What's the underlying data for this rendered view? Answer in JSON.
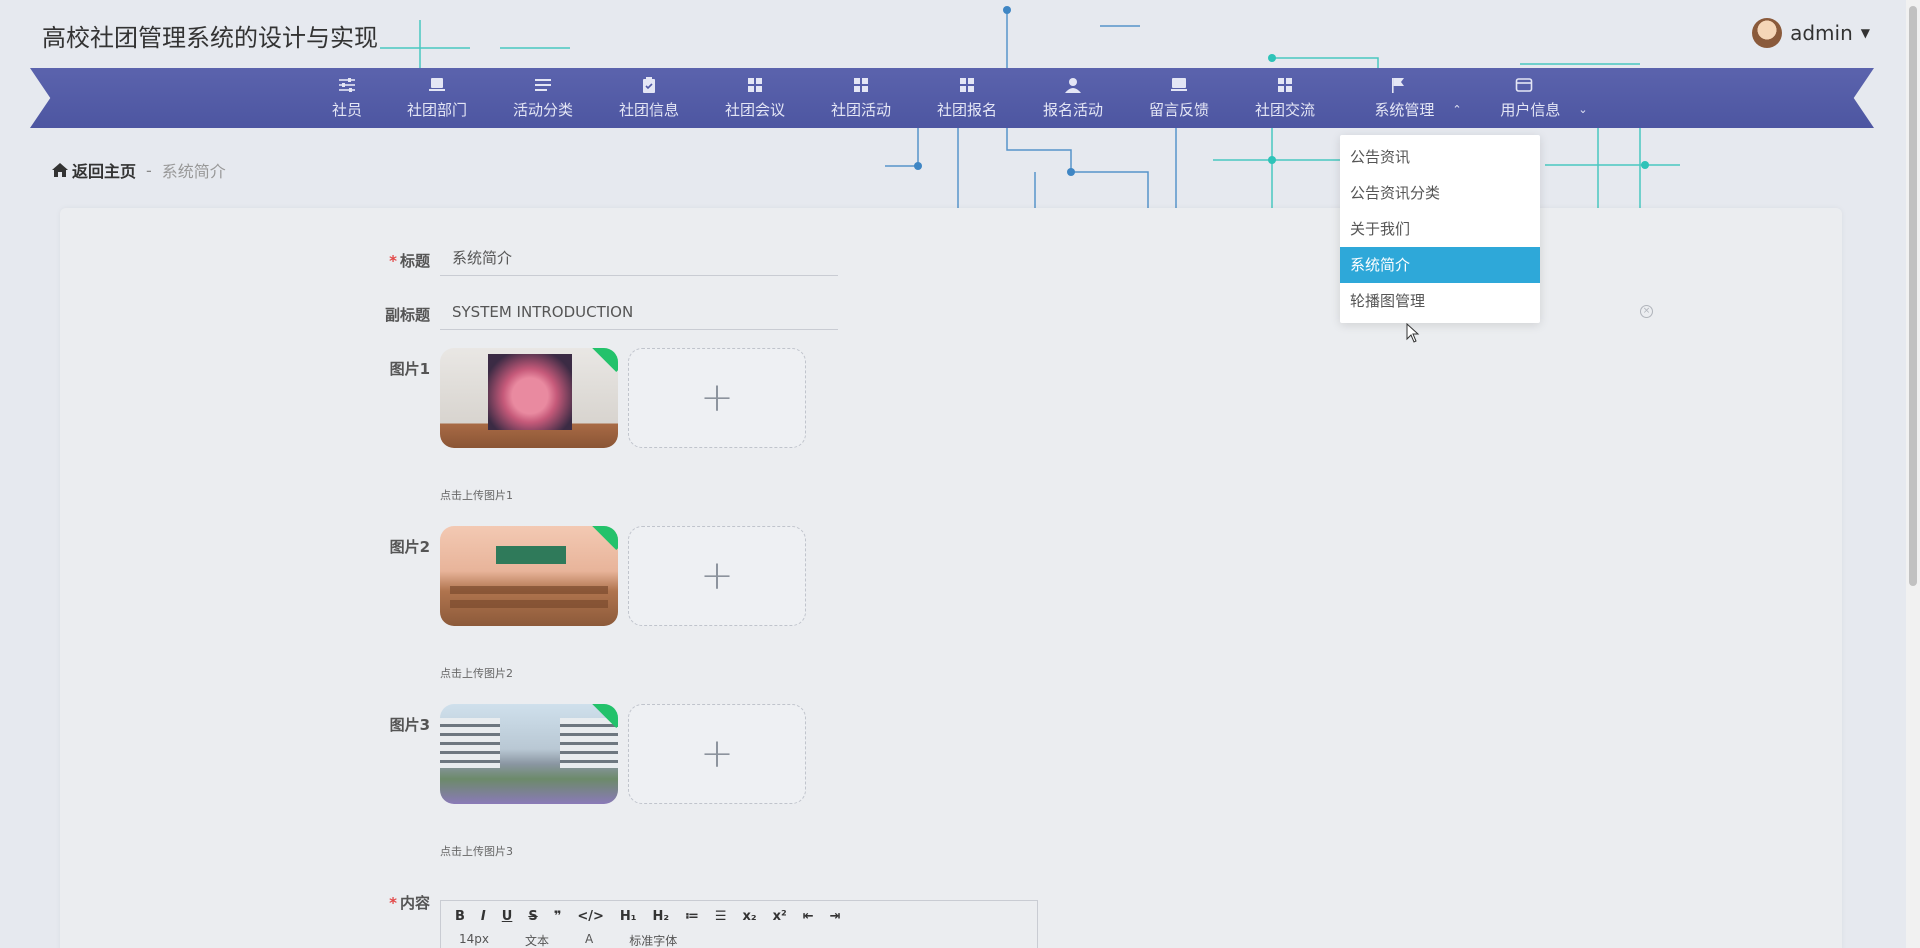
{
  "header": {
    "site_title": "高校社团管理系统的设计与实现",
    "user_name": "admin"
  },
  "nav": {
    "items": [
      {
        "label": "社员",
        "icon": "sliders-icon"
      },
      {
        "label": "社团部门",
        "icon": "chat-icon"
      },
      {
        "label": "活动分类",
        "icon": "list-icon"
      },
      {
        "label": "社团信息",
        "icon": "clipboard-icon"
      },
      {
        "label": "社团会议",
        "icon": "grid-icon"
      },
      {
        "label": "社团活动",
        "icon": "grid-icon"
      },
      {
        "label": "社团报名",
        "icon": "grid-icon"
      },
      {
        "label": "报名活动",
        "icon": "user-icon"
      },
      {
        "label": "留言反馈",
        "icon": "message-icon"
      },
      {
        "label": "社团交流",
        "icon": "grid-icon"
      },
      {
        "label": "系统管理",
        "icon": "flag-icon"
      },
      {
        "label": "用户信息",
        "icon": "wallet-icon"
      }
    ]
  },
  "dropdown": {
    "items": [
      "公告资讯",
      "公告资讯分类",
      "关于我们",
      "系统简介",
      "轮播图管理"
    ],
    "active": "系统简介"
  },
  "breadcrumb": {
    "home": "返回主页",
    "separator": "-",
    "current": "系统简介"
  },
  "form": {
    "title_label": "标题",
    "title_value": "系统简介",
    "subtitle_label": "副标题",
    "subtitle_value": "SYSTEM INTRODUCTION",
    "image1_label": "图片1",
    "image1_hint": "点击上传图片1",
    "image2_label": "图片2",
    "image2_hint": "点击上传图片2",
    "image3_label": "图片3",
    "image3_hint": "点击上传图片3",
    "content_label": "内容",
    "editor": {
      "font_size": "14px",
      "format": "文本",
      "font_family": "标准字体"
    }
  },
  "colors": {
    "nav_bg": "#5059a6",
    "dropdown_active": "#2ea8d9",
    "required": "#e24848"
  }
}
